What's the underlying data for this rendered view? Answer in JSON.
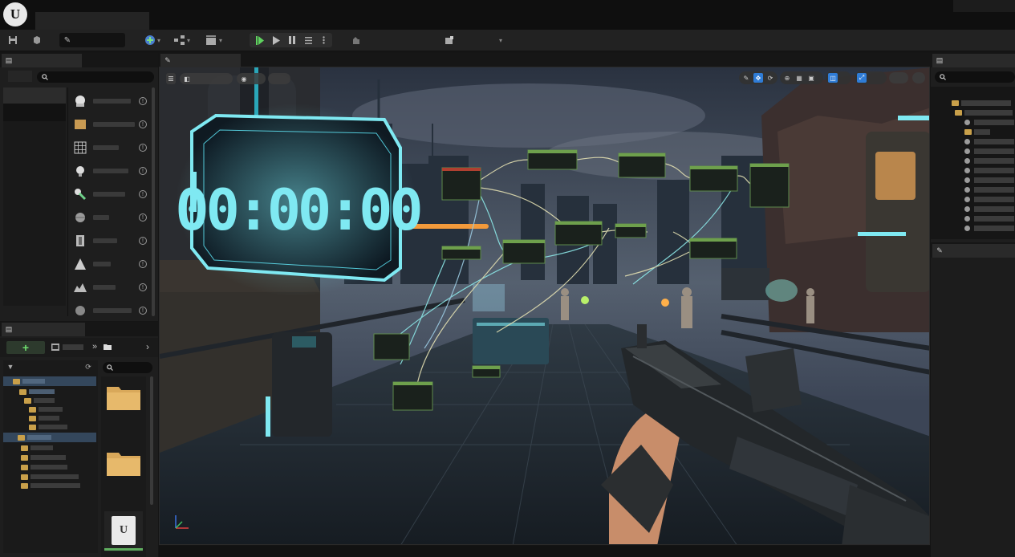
{
  "app": {
    "logo_text": "U"
  },
  "toolbar": {
    "icons": [
      "save-icon",
      "source-control-icon",
      "select-mode-icon",
      "add-content-icon",
      "blueprint-icon",
      "cinematics-icon",
      "play-icon",
      "play-alt-icon",
      "pause-icon",
      "list-icon",
      "more-icon",
      "platforms-icon",
      "settings-icon"
    ],
    "chevron": "▾"
  },
  "viewport": {
    "timer_text": "00:00:00",
    "colors": {
      "timer": "#7fe9f2",
      "accent": "#2f8fff",
      "node_green": "#5e8a4c",
      "wire": "#e0ddb0"
    }
  },
  "content_browser": {
    "add_label": "+",
    "nav_forward": "»",
    "nav_next": "›",
    "asset_logo": "U"
  },
  "colors": {
    "brand_accent": "#3b7ee0",
    "folder": "#d9a85a",
    "play_green": "#5fd35f"
  }
}
